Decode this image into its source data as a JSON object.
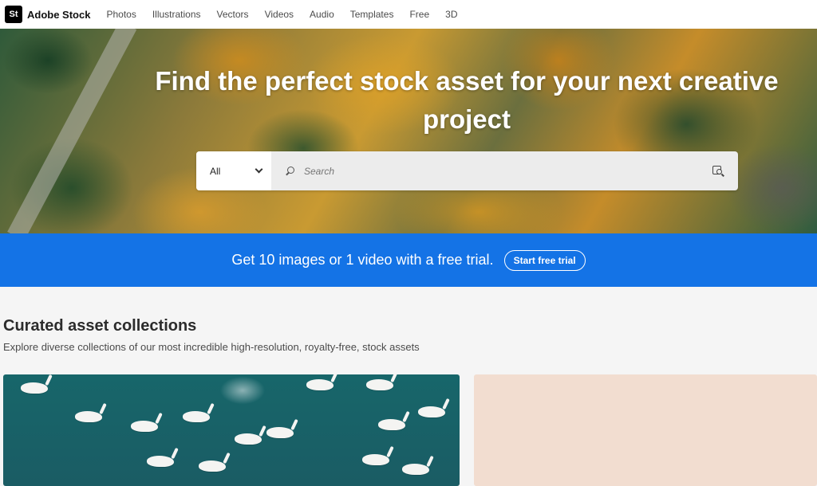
{
  "brand": {
    "logo_mark": "St",
    "name": "Adobe Stock"
  },
  "nav": {
    "items": [
      {
        "label": "Photos"
      },
      {
        "label": "Illustrations"
      },
      {
        "label": "Vectors"
      },
      {
        "label": "Videos"
      },
      {
        "label": "Audio"
      },
      {
        "label": "Templates"
      },
      {
        "label": "Free"
      },
      {
        "label": "3D"
      }
    ]
  },
  "hero": {
    "title_line1": "Find the perfect stock asset for your next creative",
    "title_line2": "project",
    "filter": {
      "selected": "All",
      "icon": "chevron-down-icon"
    },
    "search": {
      "placeholder": "Search",
      "icon": "search-icon",
      "visual_search_icon": "visual-search-icon"
    }
  },
  "promo": {
    "text": "Get 10 images or 1 video with a free trial.",
    "button": "Start free trial",
    "color": "#1473e6"
  },
  "collections": {
    "title": "Curated asset collections",
    "subtitle": "Explore diverse collections of our most incredible high-resolution, royalty-free, stock assets"
  }
}
